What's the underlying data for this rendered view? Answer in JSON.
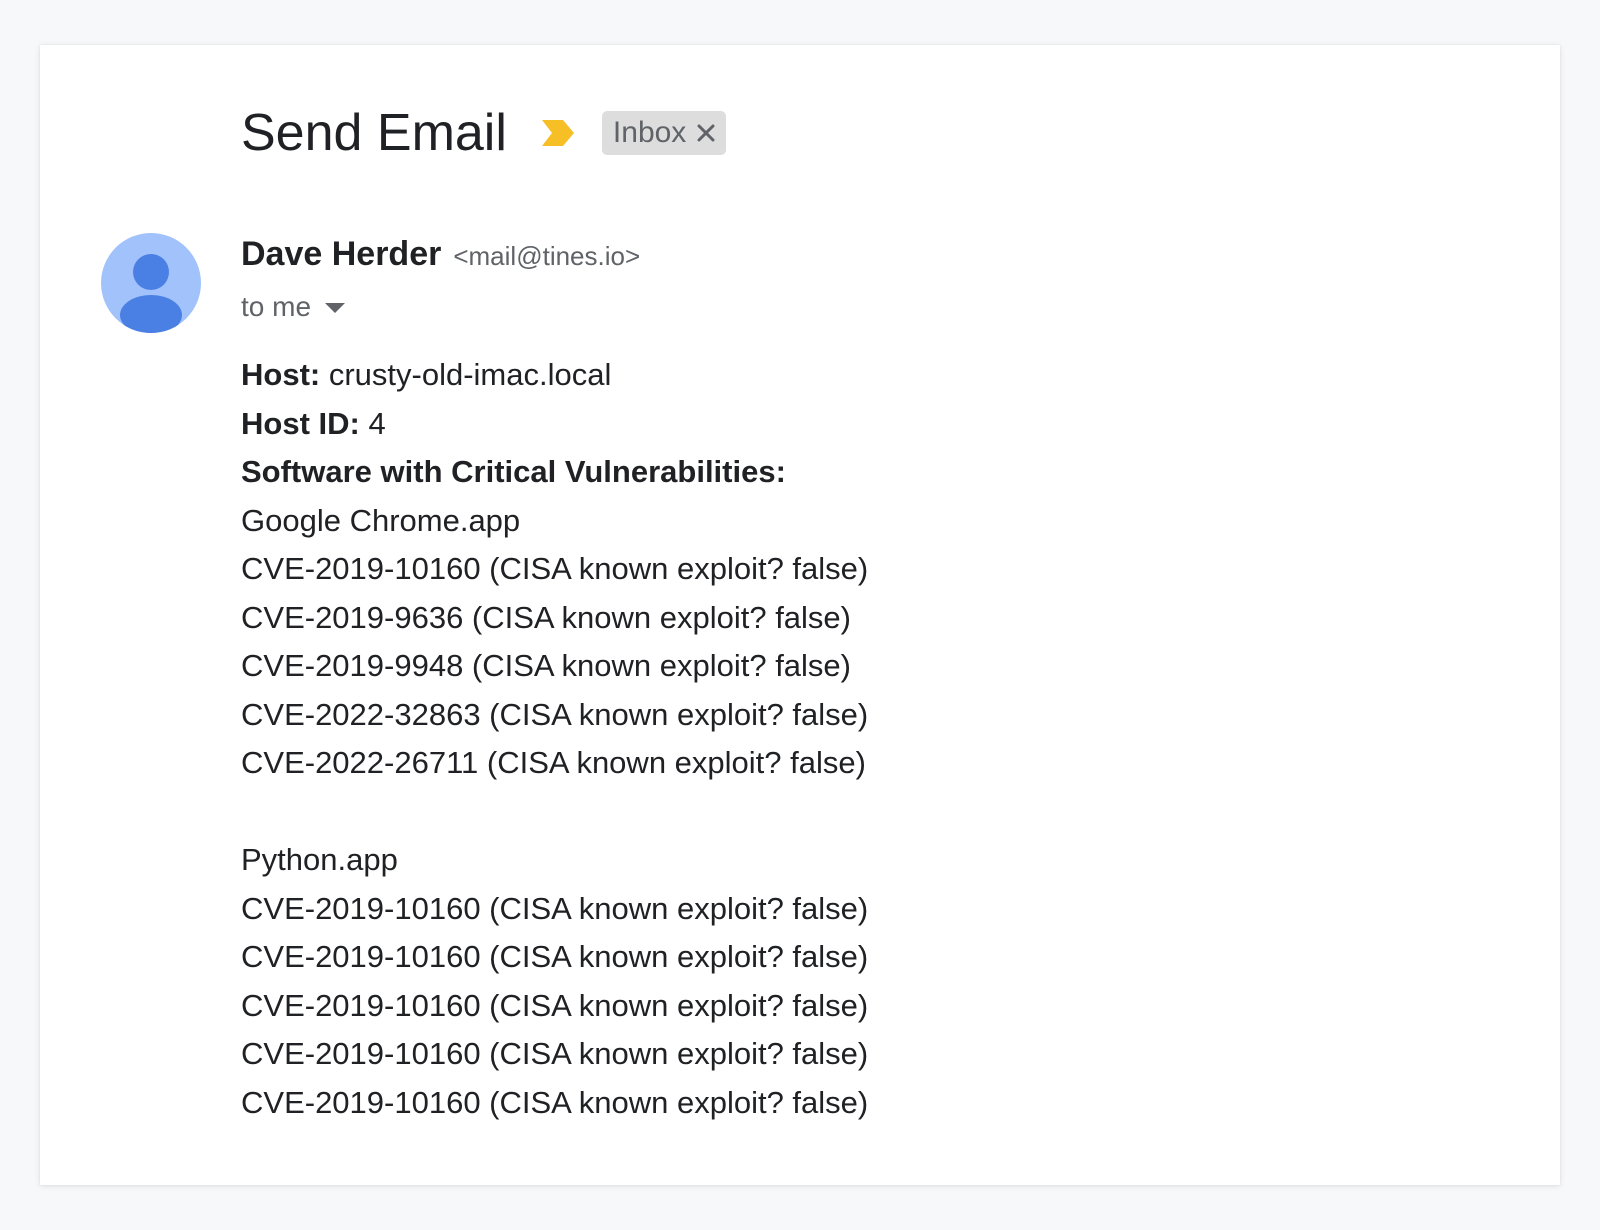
{
  "email": {
    "subject": "Send Email",
    "label": "Inbox",
    "sender_name": "Dave Herder",
    "sender_email": "<mail@tines.io>",
    "recipient": "to me"
  },
  "body": {
    "host_label": "Host:",
    "host_value": " crusty-old-imac.local",
    "host_id_label": "Host ID:",
    "host_id_value": " 4",
    "section_heading": "Software with Critical Vulnerabilities:",
    "groups": [
      {
        "app": "Google Chrome.app",
        "cves": [
          "CVE-2019-10160 (CISA known exploit? false)",
          "CVE-2019-9636 (CISA known exploit? false)",
          "CVE-2019-9948 (CISA known exploit? false)",
          "CVE-2022-32863 (CISA known exploit? false)",
          "CVE-2022-26711 (CISA known exploit? false)"
        ]
      },
      {
        "app": "Python.app",
        "cves": [
          "CVE-2019-10160 (CISA known exploit? false)",
          "CVE-2019-10160 (CISA known exploit? false)",
          "CVE-2019-10160 (CISA known exploit? false)",
          "CVE-2019-10160 (CISA known exploit? false)",
          "CVE-2019-10160 (CISA known exploit? false)"
        ]
      }
    ]
  },
  "icons": {
    "importance": "importance-marker-icon",
    "label_close": "close-icon",
    "details": "chevron-down-icon",
    "avatar": "person-icon"
  },
  "colors": {
    "importance": "#f6bf26",
    "avatar_bg": "#a1c2fa",
    "avatar_fg": "#4a7fe4",
    "label_chip_bg": "#dddddd"
  }
}
